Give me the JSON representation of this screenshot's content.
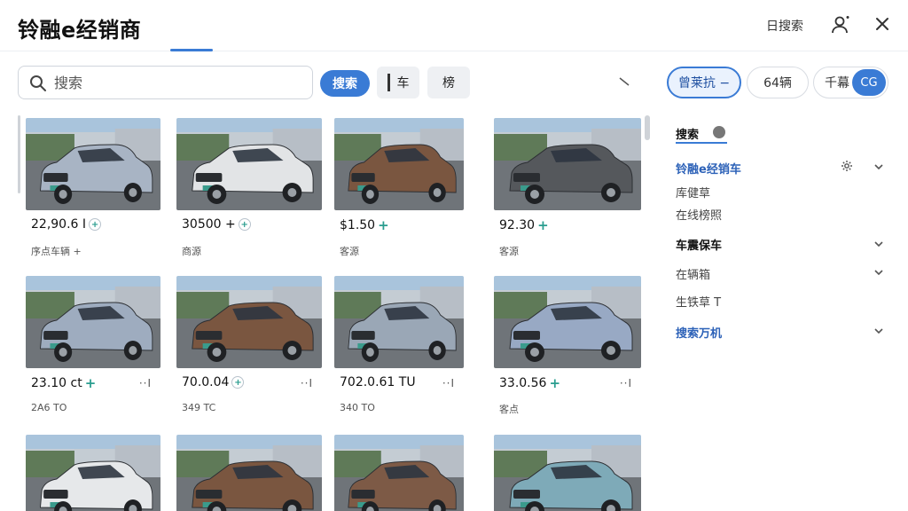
{
  "header": {
    "title": "铃融e经销商",
    "link": "日搜索",
    "colors": {
      "accent": "#3a7bd5"
    }
  },
  "search": {
    "placeholder": "搜索",
    "value": "",
    "button_label": "搜索",
    "filter_car": "车",
    "filter_rank": "榜"
  },
  "chips": {
    "active": "曾莱抗 −",
    "count": "64辆",
    "filter": "千幕",
    "badge": "CG"
  },
  "cards": [
    {
      "price": "22,90.6 I",
      "sub": "序点车辆 +",
      "paint": "#a8b4c4",
      "icon": "plus-circle",
      "more": ""
    },
    {
      "price": "30500 +",
      "sub": "商源",
      "paint": "#e2e4e6",
      "icon": "plus-circle",
      "more": ""
    },
    {
      "price": "$1.50",
      "sub": "客源",
      "paint": "#7a5640",
      "icon": "plus",
      "more": ""
    },
    {
      "price": "92.30",
      "sub": "客源",
      "paint": "#55585c",
      "icon": "plus",
      "more": ""
    },
    {
      "price": "23.10 ct",
      "sub": "2A6 TO",
      "paint": "#9eacbf",
      "icon": "plus",
      "more": "··I"
    },
    {
      "price": "70.0.04",
      "sub": "349 TC",
      "paint": "#7a5640",
      "icon": "plus-circle",
      "more": "··I"
    },
    {
      "price": "702.0.61 TU",
      "sub": "340 TO",
      "paint": "#9aa7b6",
      "icon": "",
      "more": "··I"
    },
    {
      "price": "33.0.56",
      "sub": "客点",
      "paint": "#98a9c4",
      "icon": "plus",
      "more": "··I"
    },
    {
      "price": "",
      "sub": "",
      "paint": "#e6e8ea",
      "icon": "",
      "more": ""
    },
    {
      "price": "",
      "sub": "",
      "paint": "#7a5640",
      "icon": "",
      "more": ""
    },
    {
      "price": "",
      "sub": "",
      "paint": "#7d5a46",
      "icon": "",
      "more": ""
    },
    {
      "price": "",
      "sub": "",
      "paint": "#7eaab8",
      "icon": "",
      "more": ""
    }
  ],
  "sidebar": {
    "title": "搜索",
    "items": [
      {
        "label": "铃融e经销车",
        "style": "blue"
      },
      {
        "label": "库健草",
        "style": "plain"
      },
      {
        "label": "在线榜照",
        "style": "plain"
      },
      {
        "label": "车震保车",
        "style": "bold"
      },
      {
        "label": "在辆箱",
        "style": "plain"
      },
      {
        "label": "生铁草 T",
        "style": "plain"
      },
      {
        "label": "搜索万机",
        "style": "blue"
      }
    ]
  }
}
